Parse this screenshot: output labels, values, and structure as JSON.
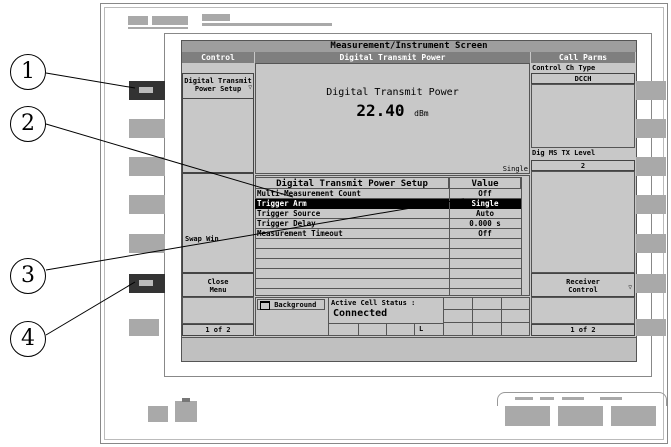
{
  "screen_title": "Measurement/Instrument Screen",
  "left_menu": {
    "header": "Control",
    "key1": [
      "Digital Transmit",
      "Power Setup"
    ],
    "key5": "Swap Win",
    "key6": [
      "Close",
      "Menu"
    ],
    "page": "1 of 2"
  },
  "right_menu": {
    "header": "Call Parms",
    "control_ch_type_label": "Control Ch Type",
    "control_ch_type_value": "DCCH",
    "dig_ms_tx_label": "Dig MS TX Level",
    "dig_ms_tx_value": "2",
    "receiver_control": [
      "Receiver",
      "Control"
    ],
    "page": "1 of 2"
  },
  "measurement": {
    "header": "Digital Transmit Power",
    "label": "Digital Transmit Power",
    "value": "22.40",
    "unit": "dBm",
    "mode": "Single"
  },
  "setup_table": {
    "col_setup": "Digital Transmit Power Setup",
    "col_value": "Value",
    "rows": [
      {
        "name": "Multi-Measurement Count",
        "value": "Off"
      },
      {
        "name": "Trigger Arm",
        "value": "Single"
      },
      {
        "name": "Trigger Source",
        "value": "Auto"
      },
      {
        "name": "Trigger Delay",
        "value": "0.000  s"
      },
      {
        "name": "Measurement Timeout",
        "value": "Off"
      }
    ]
  },
  "status": {
    "background": "Background",
    "active_cell_label": "Active Cell Status :",
    "active_cell_value": "Connected",
    "indicator": "L"
  },
  "callouts": [
    "1",
    "2",
    "3",
    "4"
  ]
}
